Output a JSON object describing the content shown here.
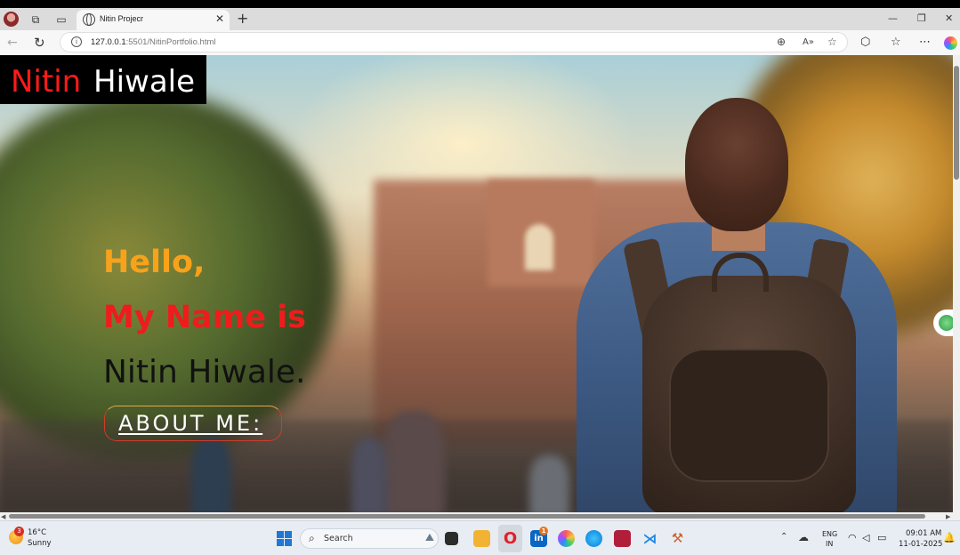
{
  "browser": {
    "tab_title": "Nitin Projecr",
    "url_host": "127.0.0.1",
    "url_rest": ":5501/NitinPortfolio.html",
    "tab_close": "✕",
    "new_tab": "+",
    "window_buttons": {
      "minimize": "—",
      "restore": "❐",
      "close": "✕"
    }
  },
  "page": {
    "logo_first": "Nitin",
    "logo_last": "Hiwale",
    "greeting": "Hello,",
    "name_intro": "My Name is",
    "full_name": "Nitin Hiwale.",
    "about_button": "ABOUT ME:"
  },
  "colors": {
    "logo_accent": "#ff1a1a",
    "greeting": "#f7a21b",
    "name_intro": "#ee1c1c",
    "name": "#111111"
  },
  "taskbar": {
    "weather_temp": "16°C",
    "weather_condition": "Sunny",
    "weather_badge": "3",
    "search_label": "Search",
    "language_top": "ENG",
    "language_bottom": "IN",
    "time": "09:01 AM",
    "date": "11-01-2025",
    "linkedin_badge": "1"
  },
  "icons": [
    "profile-avatar",
    "workspaces-icon",
    "tab-actions-icon",
    "globe-icon",
    "back-icon",
    "refresh-icon",
    "info-icon",
    "zoom-icon",
    "read-aloud-icon",
    "favorite-icon",
    "extensions-icon",
    "favorites-icon",
    "more-icon",
    "copilot-icon",
    "weather-icon",
    "windows-start-icon",
    "search-icon",
    "chevron-up-icon",
    "onedrive-icon",
    "wifi-icon",
    "volume-icon",
    "battery-icon",
    "notification-icon"
  ]
}
